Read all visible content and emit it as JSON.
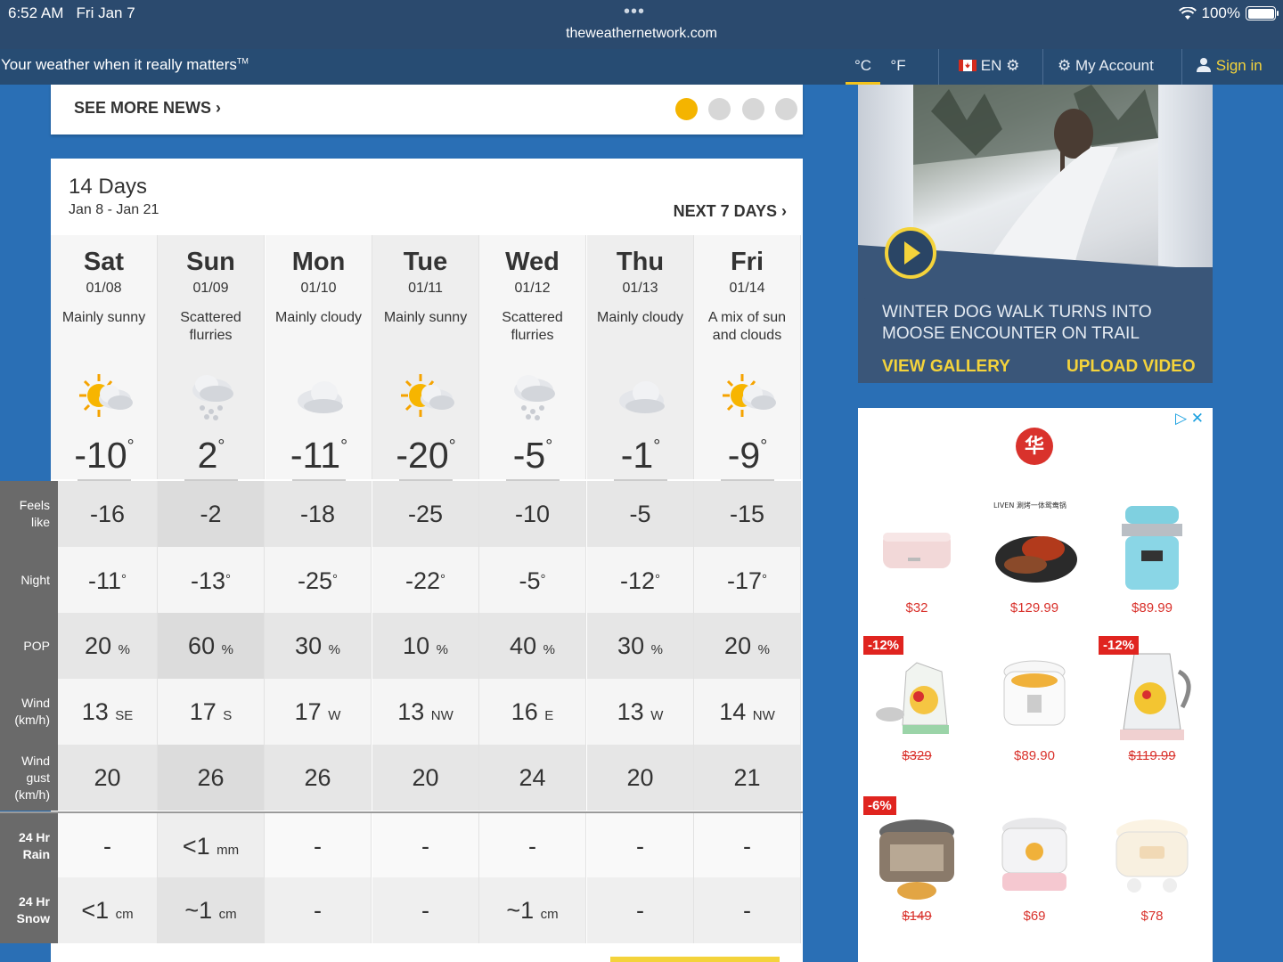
{
  "status_bar": {
    "time": "6:52 AM",
    "date": "Fri Jan 7",
    "url": "theweathernetwork.com",
    "battery": "100%"
  },
  "header": {
    "tagline": "Your weather when it really matters",
    "tm": "TM",
    "unit_c": "°C",
    "unit_f": "°F",
    "language": "EN",
    "account": "My Account",
    "signin": "Sign in"
  },
  "news": {
    "see_more": "SEE MORE NEWS ›"
  },
  "forecast": {
    "title": "14 Days",
    "range": "Jan 8 - Jan 21",
    "next": "NEXT 7 DAYS ›",
    "days": [
      {
        "name": "Sat",
        "date": "01/08",
        "cond": "Mainly sunny",
        "icon": "sun-cloud-icon",
        "temp": "-10"
      },
      {
        "name": "Sun",
        "date": "01/09",
        "cond": "Scattered flurries",
        "icon": "snow-cloud-icon",
        "temp": "2"
      },
      {
        "name": "Mon",
        "date": "01/10",
        "cond": "Mainly cloudy",
        "icon": "cloud-icon",
        "temp": "-11"
      },
      {
        "name": "Tue",
        "date": "01/11",
        "cond": "Mainly sunny",
        "icon": "sun-cloud-icon",
        "temp": "-20"
      },
      {
        "name": "Wed",
        "date": "01/12",
        "cond": "Scattered flurries",
        "icon": "snow-cloud-icon",
        "temp": "-5"
      },
      {
        "name": "Thu",
        "date": "01/13",
        "cond": "Mainly cloudy",
        "icon": "cloud-icon",
        "temp": "-1"
      },
      {
        "name": "Fri",
        "date": "01/14",
        "cond": "A mix of sun and clouds",
        "icon": "sun-cloud-icon",
        "temp": "-9"
      }
    ],
    "degree": "°",
    "rows": {
      "feels": {
        "label": "Feels like",
        "values": [
          "-16",
          "-2",
          "-18",
          "-25",
          "-10",
          "-5",
          "-15"
        ]
      },
      "night": {
        "label": "Night",
        "values": [
          "-11",
          "-13",
          "-25",
          "-22",
          "-5",
          "-12",
          "-17"
        ]
      },
      "pop": {
        "label": "POP",
        "unit": "%",
        "values": [
          "20",
          "60",
          "30",
          "10",
          "40",
          "30",
          "20"
        ]
      },
      "wind": {
        "label1": "Wind",
        "label2": "(km/h)",
        "values": [
          "13",
          "17",
          "17",
          "13",
          "16",
          "13",
          "14"
        ],
        "dirs": [
          "SE",
          "S",
          "W",
          "NW",
          "E",
          "W",
          "NW"
        ]
      },
      "gust": {
        "label1": "Wind gust",
        "label2": "(km/h)",
        "values": [
          "20",
          "26",
          "26",
          "20",
          "24",
          "20",
          "21"
        ]
      },
      "rain": {
        "label1": "24 Hr",
        "label2": "Rain",
        "values": [
          "-",
          "<1",
          "-",
          "-",
          "-",
          "-",
          "-"
        ],
        "units": [
          "",
          "mm",
          "",
          "",
          "",
          "",
          ""
        ]
      },
      "snow": {
        "label1": "24 Hr",
        "label2": "Snow",
        "values": [
          "<1",
          "~1",
          "-",
          "-",
          "~1",
          "-",
          "-"
        ],
        "units": [
          "cm",
          "cm",
          "",
          "",
          "cm",
          "",
          ""
        ]
      }
    }
  },
  "video": {
    "headline": "WINTER DOG WALK TURNS INTO MOOSE ENCOUNTER ON TRAIL",
    "gallery": "VIEW GALLERY",
    "upload": "UPLOAD VIDEO"
  },
  "ad": {
    "adchoice": "▷ ✕",
    "brand_mark": "华",
    "products": [
      {
        "price": "$32",
        "strike": false,
        "discount": ""
      },
      {
        "price": "$129.99",
        "strike": false,
        "discount": "",
        "label": "LIVEN 涮烤一体鸳鸯锅"
      },
      {
        "price": "$89.99",
        "strike": false,
        "discount": ""
      },
      {
        "price": "$329",
        "strike": true,
        "discount": "-12%"
      },
      {
        "price": "$89.90",
        "strike": false,
        "discount": ""
      },
      {
        "price": "$119.99",
        "strike": true,
        "discount": "-12%"
      },
      {
        "price": "$149",
        "strike": true,
        "discount": "-6%"
      },
      {
        "price": "$69",
        "strike": false,
        "discount": ""
      },
      {
        "price": "$78",
        "strike": false,
        "discount": ""
      }
    ]
  },
  "colors": {
    "accent": "#f4d33b",
    "header": "#274c73",
    "background": "#2a6fb5",
    "sale": "#d9322c"
  }
}
